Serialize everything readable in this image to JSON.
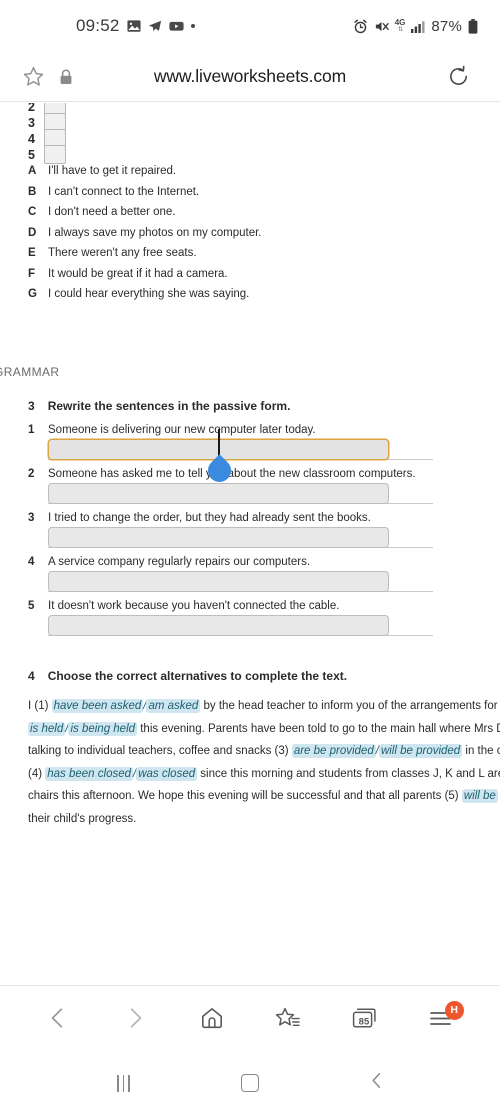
{
  "status_bar": {
    "time": "09:52",
    "left_icons": [
      "gallery-icon",
      "telegram-icon",
      "youtube-icon",
      "dot-indicator"
    ],
    "alarm_icon": "alarm-icon",
    "mute_icon": "volume-mute-icon",
    "network_type": "4G",
    "signal_icon": "signal-bars-icon",
    "battery_percent": "87%",
    "battery_icon": "battery-icon"
  },
  "browser": {
    "url": "www.liveworksheets.com",
    "bookmark_icon": "star-outline-icon",
    "lock_icon": "lock-icon",
    "reload_icon": "reload-icon"
  },
  "worksheet": {
    "top_rows": [
      {
        "num": "2"
      },
      {
        "num": "3"
      },
      {
        "num": "4"
      },
      {
        "num": "5"
      }
    ],
    "answers": [
      {
        "letter": "A",
        "text": "I'll have to get it repaired."
      },
      {
        "letter": "B",
        "text": "I can't connect to the Internet."
      },
      {
        "letter": "C",
        "text": "I don't need a better one."
      },
      {
        "letter": "D",
        "text": "I always save my photos on my computer."
      },
      {
        "letter": "E",
        "text": "There weren't any free seats."
      },
      {
        "letter": "F",
        "text": "It would be great if it had a camera."
      },
      {
        "letter": "G",
        "text": "I could hear everything she was saying."
      }
    ],
    "section_label": "GRAMMAR",
    "exercise3": {
      "number": "3",
      "heading": "Rewrite the sentences in the passive form.",
      "questions": [
        {
          "num": "1",
          "text": "Someone is delivering our new computer later today.",
          "value": "",
          "focused": true
        },
        {
          "num": "2",
          "text": "Someone has asked me to tell you about the new classroom computers.",
          "value": "",
          "focused": false
        },
        {
          "num": "3",
          "text": "I tried to change the order, but they had already sent the books.",
          "value": "",
          "focused": false
        },
        {
          "num": "4",
          "text": "A service company regularly repairs our computers.",
          "value": "",
          "focused": false
        },
        {
          "num": "5",
          "text": "It doesn't work because you haven't connected the cable.",
          "value": "",
          "focused": false
        }
      ]
    },
    "exercise4": {
      "number": "4",
      "heading": "Choose the correct alternatives to complete the text.",
      "lines": [
        {
          "parts": [
            {
              "type": "plain",
              "text": "I (1) "
            },
            {
              "type": "alt",
              "text": "have been asked"
            },
            {
              "type": "sep",
              "text": "/"
            },
            {
              "type": "alt",
              "text": "am asked"
            },
            {
              "type": "plain",
              "text": " by the head teacher to inform you of the arrangements for th"
            }
          ]
        },
        {
          "parts": [
            {
              "type": "alt",
              "text": "is held"
            },
            {
              "type": "sep",
              "text": "/"
            },
            {
              "type": "alt",
              "text": "is being held"
            },
            {
              "type": "plain",
              "text": " this evening. Parents have been told to go to the main hall where Mrs Da"
            }
          ]
        },
        {
          "parts": [
            {
              "type": "plain",
              "text": "talking to individual teachers, coffee and snacks (3) "
            },
            {
              "type": "alt",
              "text": "are be provided"
            },
            {
              "type": "sep",
              "text": "/"
            },
            {
              "type": "alt",
              "text": "will be provided"
            },
            {
              "type": "plain",
              "text": " in the ca"
            }
          ]
        },
        {
          "parts": [
            {
              "type": "plain",
              "text": "(4) "
            },
            {
              "type": "alt",
              "text": "has been closed"
            },
            {
              "type": "sep",
              "text": "/"
            },
            {
              "type": "alt",
              "text": "was closed"
            },
            {
              "type": "plain",
              "text": " since this morning and students from classes J, K and L are exp"
            }
          ]
        },
        {
          "parts": [
            {
              "type": "plain",
              "text": "chairs this afternoon. We hope this evening will be successful and that all parents (5) "
            },
            {
              "type": "alt",
              "text": "will be"
            }
          ]
        },
        {
          "parts": [
            {
              "type": "plain",
              "text": "their child's progress."
            }
          ]
        }
      ]
    }
  },
  "browser_nav": {
    "back_icon": "chevron-left-icon",
    "forward_icon": "chevron-right-icon",
    "home_icon": "home-icon",
    "bookmarks_icon": "star-list-icon",
    "tabs_icon": "tabs-icon",
    "tab_count": "85",
    "menu_icon": "menu-icon",
    "menu_badge": "H",
    "badge_color": "#f0562d"
  },
  "system_nav": {
    "recents_icon": "recents-icon",
    "home_icon": "home-square-icon",
    "back_icon": "back-chevron-icon"
  }
}
